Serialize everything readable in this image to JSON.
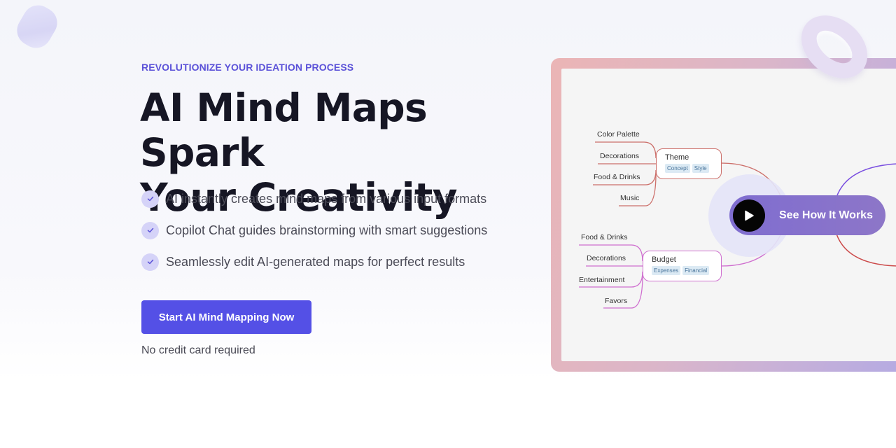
{
  "hero": {
    "eyebrow": "REVOLUTIONIZE YOUR IDEATION PROCESS",
    "headline_line1": "AI Mind Maps Spark",
    "headline_line2": "Your Creativity",
    "features": [
      {
        "icon": "check-icon",
        "text": "AI instantly creates mind maps from various input formats"
      },
      {
        "icon": "check-icon",
        "text": "Copilot Chat guides brainstorming with smart suggestions"
      },
      {
        "icon": "check-icon",
        "text": "Seamlessly edit AI-generated maps for perfect results"
      }
    ],
    "cta_label": "Start AI Mind Mapping Now",
    "cta_note": "No credit card required"
  },
  "preview": {
    "video_button_label": "See How It Works",
    "video_button_icon": "play-icon",
    "mind_map": {
      "branches": [
        {
          "title": "Theme",
          "tags": [
            "Concept",
            "Style"
          ],
          "color": "#cc6f6a",
          "children": [
            "Color Palette",
            "Decorations",
            "Food & Drinks",
            "Music"
          ]
        },
        {
          "title": "Budget",
          "tags": [
            "Expenses",
            "Financial"
          ],
          "color": "#cf6fcf",
          "children": [
            "Food & Drinks",
            "Decorations",
            "Entertainment",
            "Favors"
          ]
        }
      ],
      "right_branch_colors": [
        "#7a4fe0",
        "#cc4a4a"
      ]
    }
  },
  "colors": {
    "accent": "#5450e6",
    "eyebrow": "#5b52d8",
    "headline": "#161624"
  }
}
